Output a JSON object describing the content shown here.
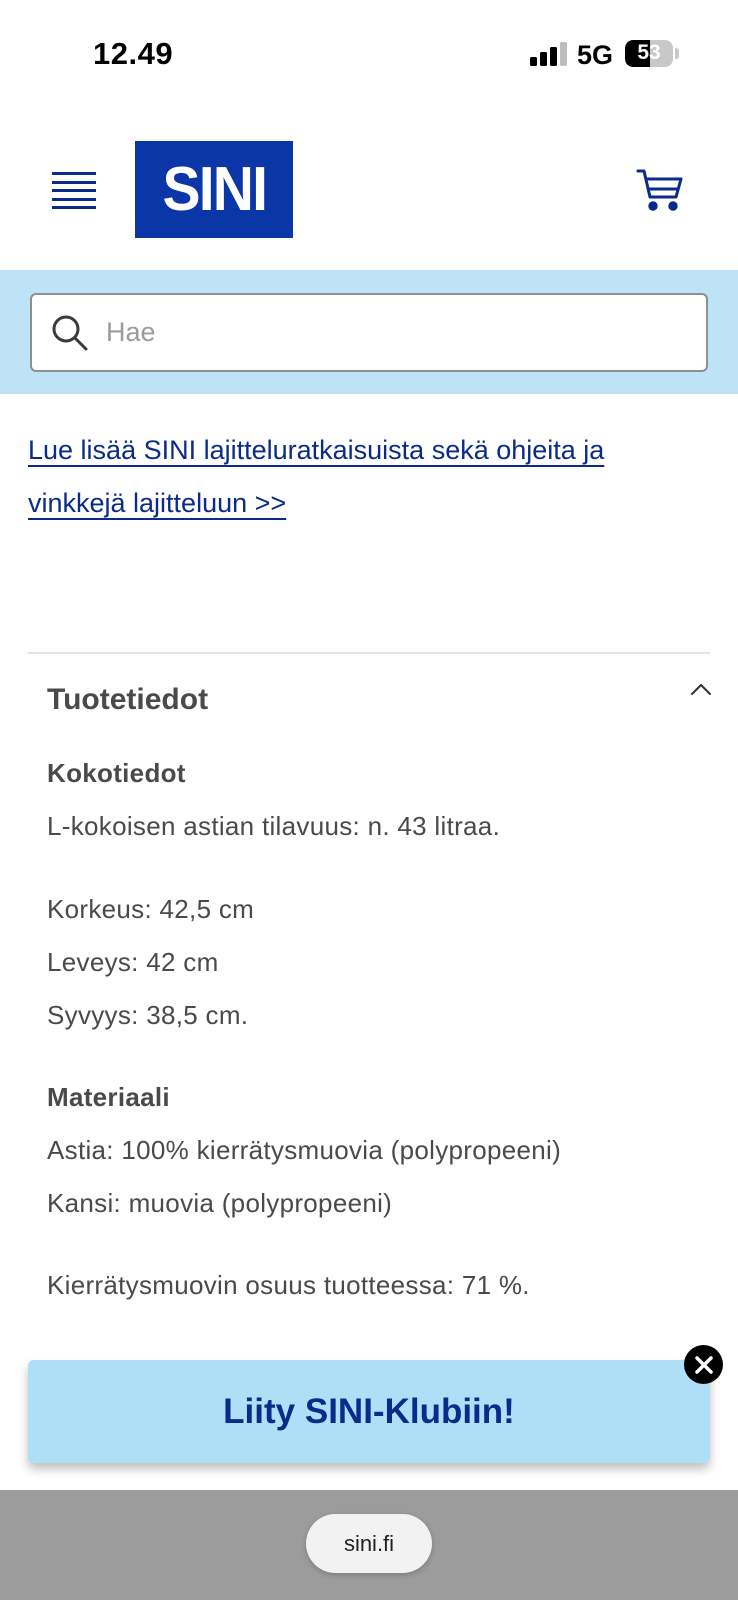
{
  "status_bar": {
    "time": "12.49",
    "network": "5G",
    "battery_level": "53",
    "battery_fraction": 0.53
  },
  "header": {
    "logo_text": "SINI",
    "menu_icon": "hamburger-menu-icon",
    "cart_icon": "shopping-cart-icon"
  },
  "search": {
    "placeholder": "Hae",
    "icon": "search-icon"
  },
  "info_link": "Lue lisää SINI lajitteluratkaisuista sekä ohjeita ja vinkkejä lajitteluun >>",
  "product_info": {
    "title": "Tuotetiedot",
    "expanded": true,
    "size_heading": "Kokotiedot",
    "volume": "L-kokoisen astian tilavuus: n. 43 litraa.",
    "height": "Korkeus: 42,5 cm",
    "width": "Leveys: 42 cm",
    "depth": "Syvyys: 38,5 cm.",
    "material_heading": "Materiaali",
    "material_container": "Astia: 100% kierrätysmuovia (polypropeeni)",
    "material_lid": "Kansi: muovia (polypropeeni)",
    "recycled_share": "Kierrätysmuovin osuus tuotteessa: 71 %."
  },
  "banner": {
    "text": "Liity SINI-Klubiin!"
  },
  "browser": {
    "url": "sini.fi"
  },
  "colors": {
    "brand_blue": "#0a36a8",
    "link_blue": "#0a2b8a",
    "search_band": "#bfe3f6",
    "banner_bg": "#aedff7",
    "text_gray": "#4a4a4a"
  }
}
